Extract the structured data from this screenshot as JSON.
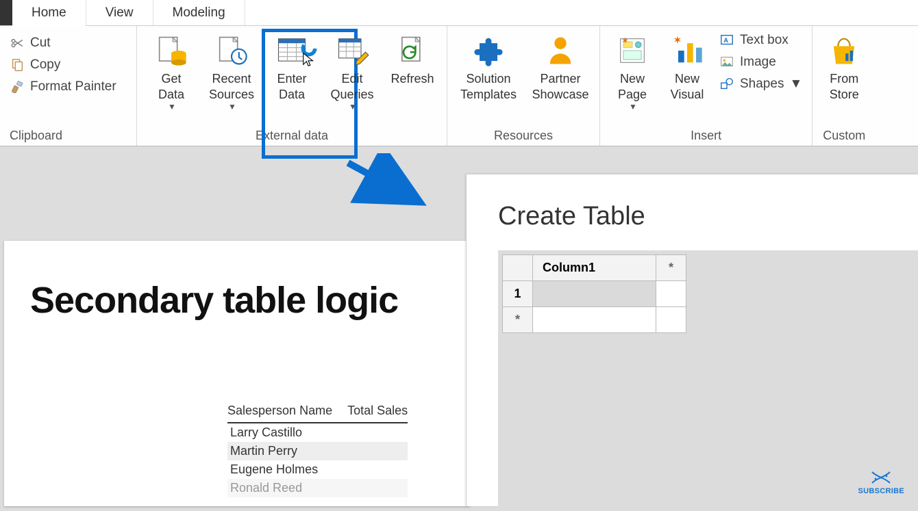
{
  "tabs": {
    "home": "Home",
    "view": "View",
    "modeling": "Modeling"
  },
  "clipboard": {
    "cut": "Cut",
    "copy": "Copy",
    "format_painter": "Format Painter",
    "group": "Clipboard"
  },
  "external": {
    "get_data": "Get\nData",
    "recent_sources": "Recent\nSources",
    "enter_data": "Enter\nData",
    "edit_queries": "Edit\nQueries",
    "refresh": "Refresh",
    "group": "External data"
  },
  "resources": {
    "solution_templates": "Solution\nTemplates",
    "partner_showcase": "Partner\nShowcase",
    "group": "Resources"
  },
  "insert": {
    "new_page": "New\nPage",
    "new_visual": "New\nVisual",
    "text_box": "Text box",
    "image": "Image",
    "shapes": "Shapes",
    "group": "Insert"
  },
  "custom": {
    "from_store": "From\nStore",
    "group": "Custom "
  },
  "report": {
    "title": "Secondary table logic",
    "columns": {
      "c1": "Salesperson Name",
      "c2": "Total Sales"
    },
    "rows": [
      "Larry Castillo",
      "Martin Perry",
      "Eugene Holmes",
      "Ronald Reed"
    ]
  },
  "dialog": {
    "title": "Create Table",
    "column1": "Column1",
    "row1": "1",
    "star": "*"
  },
  "subscribe": "SUBSCRIBE"
}
